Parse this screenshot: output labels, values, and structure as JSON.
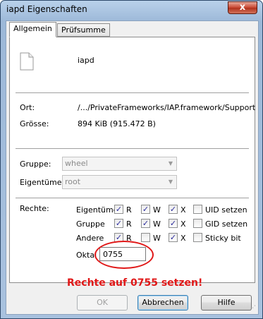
{
  "window": {
    "title": "iapd Eigenschaften",
    "close_glyph": "x"
  },
  "tabs": [
    {
      "label": "Allgemein",
      "active": true
    },
    {
      "label": "Prüfsumme",
      "active": false
    }
  ],
  "file": {
    "name": "iapd",
    "icon": "file-icon"
  },
  "info": {
    "ort_label": "Ort:",
    "ort_value": "/.../PrivateFrameworks/IAP.framework/Support",
    "groesse_label": "Grösse:",
    "groesse_value": "894 KiB (915.472 B)"
  },
  "ownership": {
    "gruppe_label": "Gruppe:",
    "gruppe_value": "wheel",
    "eigentuemer_label": "Eigentümer:",
    "eigentuemer_value": "root"
  },
  "rights": {
    "label": "Rechte:",
    "rows": [
      {
        "name": "Eigentümer",
        "r": true,
        "w": true,
        "x": true,
        "extra_label": "UID setzen",
        "extra": false
      },
      {
        "name": "Gruppe",
        "r": true,
        "w": true,
        "x": true,
        "extra_label": "GID setzen",
        "extra": false
      },
      {
        "name": "Andere",
        "r": true,
        "w": false,
        "x": true,
        "extra_label": "Sticky bit",
        "extra": false
      }
    ],
    "col_r": "R",
    "col_w": "W",
    "col_x": "X",
    "oktal_label": "Oktal",
    "oktal_value": "0755"
  },
  "annotation": "Rechte auf 0755 setzen!",
  "buttons": {
    "ok": "OK",
    "cancel": "Abbrechen",
    "help": "Hilfe"
  },
  "colors": {
    "annotation": "#e01818",
    "check": "#2b2b9b"
  }
}
